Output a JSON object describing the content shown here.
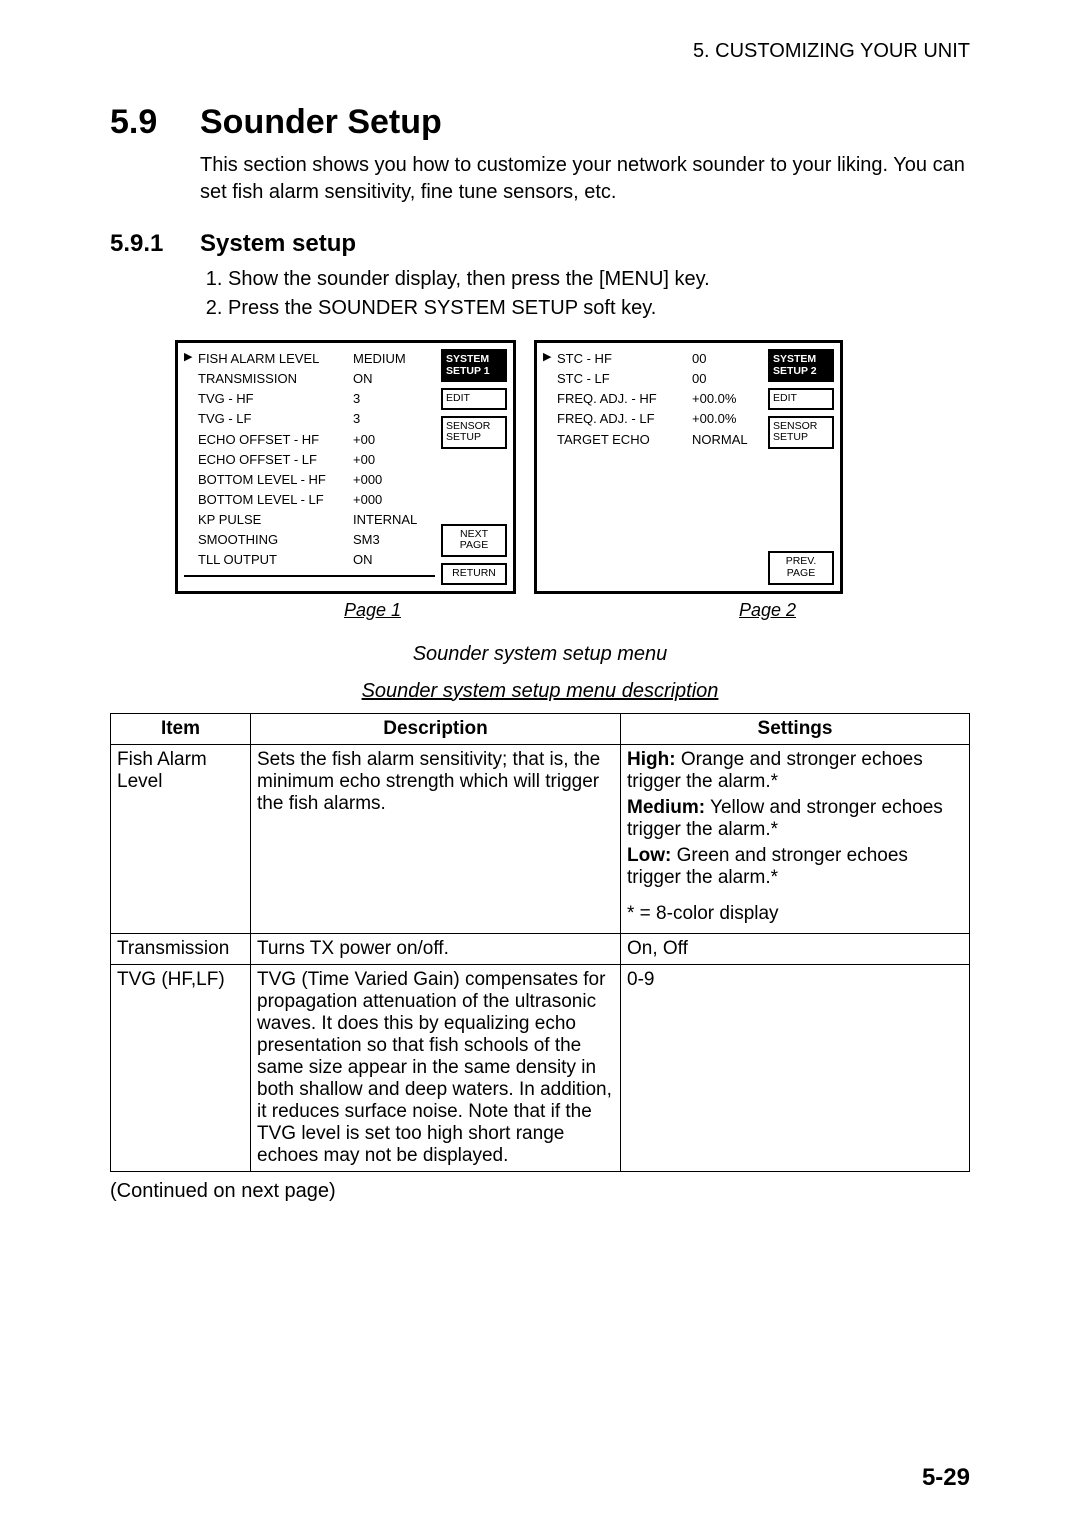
{
  "header": {
    "running": "5. CUSTOMIZING YOUR UNIT"
  },
  "section": {
    "number": "5.9",
    "title": "Sounder Setup",
    "intro": "This section shows you how to customize your network sounder to your liking. You can set fish alarm sensitivity, fine tune sensors, etc."
  },
  "subsection": {
    "number": "5.9.1",
    "title": "System setup",
    "steps": [
      "Show the sounder display, then press the [MENU] key.",
      "Press the SOUNDER SYSTEM SETUP soft key."
    ]
  },
  "menu_page1": {
    "title": "SYSTEM SETUP 1",
    "items": [
      {
        "label": "FISH ALARM LEVEL",
        "value": "MEDIUM",
        "cursor": true
      },
      {
        "label": "TRANSMISSION",
        "value": "ON"
      },
      {
        "label": "TVG - HF",
        "value": "3"
      },
      {
        "label": "TVG - LF",
        "value": "3"
      },
      {
        "label": "ECHO OFFSET - HF",
        "value": "+00"
      },
      {
        "label": "ECHO OFFSET - LF",
        "value": "+00"
      },
      {
        "label": "BOTTOM LEVEL - HF",
        "value": "+000"
      },
      {
        "label": "BOTTOM LEVEL - LF",
        "value": "+000"
      },
      {
        "label": "KP PULSE",
        "value": "INTERNAL"
      },
      {
        "label": "SMOOTHING",
        "value": "SM3"
      },
      {
        "label": "TLL OUTPUT",
        "value": "ON"
      }
    ],
    "softkeys": {
      "active": "SYSTEM SETUP 1",
      "edit": "EDIT",
      "sensor": "SENSOR SETUP",
      "next": "NEXT PAGE",
      "return": "RETURN"
    }
  },
  "menu_page2": {
    "title": "SYSTEM SETUP 2",
    "items": [
      {
        "label": "STC - HF",
        "value": "00",
        "cursor": true
      },
      {
        "label": "STC - LF",
        "value": "00"
      },
      {
        "label": "FREQ. ADJ. - HF",
        "value": "+00.0%"
      },
      {
        "label": "FREQ. ADJ. - LF",
        "value": "+00.0%"
      },
      {
        "label": "TARGET ECHO",
        "value": "NORMAL"
      }
    ],
    "softkeys": {
      "active": "SYSTEM SETUP 2",
      "edit": "EDIT",
      "sensor": "SENSOR SETUP",
      "prev": "PREV. PAGE"
    }
  },
  "captions": {
    "page1": "Page 1",
    "page2": "Page 2",
    "figure": "Sounder system setup menu",
    "table": "Sounder system setup menu description"
  },
  "table": {
    "headers": {
      "item": "Item",
      "desc": "Description",
      "settings": "Settings"
    },
    "rows": [
      {
        "item": "Fish Alarm Level",
        "desc": "Sets the fish alarm sensitivity; that is, the minimum echo strength which will trigger the fish alarms.",
        "settings_high_label": "High:",
        "settings_high_text": " Orange and stronger echoes trigger the alarm.*",
        "settings_med_label": "Medium:",
        "settings_med_text": " Yellow and stronger echoes trigger the alarm.*",
        "settings_low_label": "Low:",
        "settings_low_text": " Green and stronger echoes trigger the alarm.*",
        "settings_note": "* = 8-color display"
      },
      {
        "item": "Transmission",
        "desc": "Turns TX power on/off.",
        "settings": "On, Off"
      },
      {
        "item": "TVG (HF,LF)",
        "desc": "TVG (Time Varied Gain) compensates for propagation attenuation of the ultrasonic waves. It does this by equalizing echo presentation so that fish schools of the same size appear in the same density in both shallow and deep waters. In addition, it reduces surface noise. Note that if the TVG level is set too high short range echoes may not be displayed.",
        "settings": "0-9"
      }
    ]
  },
  "continued": "(Continued on next page)",
  "pagenum": "5-29"
}
